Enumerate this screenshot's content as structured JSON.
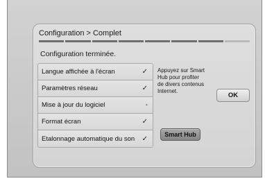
{
  "dialog": {
    "title": "Configuration > Complet",
    "progress_steps_total": 8,
    "progress_steps_complete": 7,
    "status": "Configuration terminée."
  },
  "checklist": [
    {
      "label": "Langue affichée à l'écran",
      "mark": "✓"
    },
    {
      "label": "Paramètres réseau",
      "mark": "✓"
    },
    {
      "label": "Mise à jour du logiciel",
      "mark": "-"
    },
    {
      "label": "Format écran",
      "mark": "✓"
    },
    {
      "label": "Etalonnage automatique du son",
      "mark": "✓"
    }
  ],
  "hint": {
    "line1": "Appuyez sur Smart",
    "line2": "Hub pour profiter",
    "line3": "de divers contenus",
    "line4": "Internet."
  },
  "buttons": {
    "ok": "OK",
    "smart_hub": "Smart Hub"
  },
  "colors": {
    "background": "#cccccc",
    "panel": "#d8d8d8",
    "progress_done": "#6d6d6d",
    "progress_pending": "#b9b9b9"
  }
}
